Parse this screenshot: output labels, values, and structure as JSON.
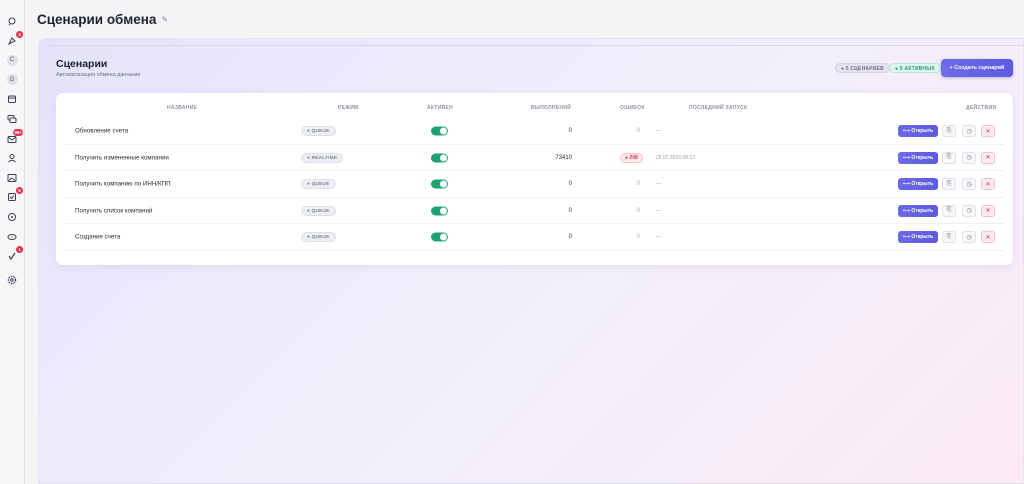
{
  "header": {
    "title": "Сценарии обмена",
    "edit_icon": "pencil-icon"
  },
  "sidebar": {
    "items": [
      {
        "icon": "home-icon",
        "badge": ""
      },
      {
        "icon": "rocket-icon",
        "badge": "4"
      },
      {
        "icon": "avatar",
        "text": "C",
        "badge": ""
      },
      {
        "icon": "ai-icon",
        "text": "G",
        "badge": ""
      },
      {
        "icon": "calendar-icon",
        "badge": ""
      },
      {
        "icon": "chat-icon",
        "badge": ""
      },
      {
        "icon": "mail-icon",
        "badge": "99+"
      },
      {
        "icon": "users-icon",
        "badge": ""
      },
      {
        "icon": "image-icon",
        "badge": ""
      },
      {
        "icon": "tasks-icon",
        "badge": "5"
      },
      {
        "icon": "help-icon",
        "badge": ""
      },
      {
        "icon": "infinity-icon",
        "badge": ""
      },
      {
        "icon": "check-icon",
        "badge": "1"
      },
      {
        "icon": "gear-icon",
        "badge": ""
      }
    ]
  },
  "section": {
    "title": "Сценарии",
    "subtitle": "Автоматизация обмена данными",
    "chip_total": "● 5 СЦЕНАРИЕВ",
    "chip_active": "● 5 АКТИВНЫХ",
    "create_button": "+ Создать сценарий"
  },
  "table": {
    "columns": {
      "name": "НАЗВАНИЕ",
      "mode": "РЕЖИМ",
      "active": "АКТИВЕН",
      "executed": "ВЫПОЛНЕНИЙ",
      "errors": "ОШИБОК",
      "last_run": "ПОСЛЕДНИЙ ЗАПУСК",
      "actions": "ДЕЙСТВИЯ"
    },
    "open_label": "⟷ Открыть",
    "rows": [
      {
        "name": "Обновление счета",
        "mode": "● QUEUE",
        "active": true,
        "executed": "0",
        "errors": "0",
        "errors_flag": false,
        "last_run": "—"
      },
      {
        "name": "Получить измененные компании",
        "mode": "● REALTIME",
        "active": true,
        "executed": "73410",
        "errors": "● 208",
        "errors_flag": true,
        "last_run": "28.07.2026 08:13"
      },
      {
        "name": "Получить компанию по ИНН/КПП",
        "mode": "● QUEUE",
        "active": true,
        "executed": "0",
        "errors": "0",
        "errors_flag": false,
        "last_run": "—"
      },
      {
        "name": "Получить список компаний",
        "mode": "● QUEUE",
        "active": true,
        "executed": "0",
        "errors": "0",
        "errors_flag": false,
        "last_run": "—"
      },
      {
        "name": "Создание счета",
        "mode": "● QUEUE",
        "active": true,
        "executed": "0",
        "errors": "0",
        "errors_flag": false,
        "last_run": "—"
      }
    ]
  },
  "colors": {
    "accent": "#5d5be0",
    "success": "#1fa36e",
    "danger": "#d9354d"
  }
}
